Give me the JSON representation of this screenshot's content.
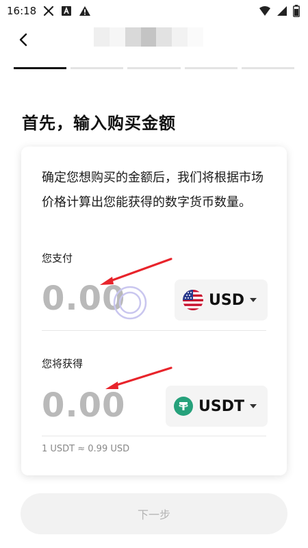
{
  "status_bar": {
    "time": "16:18",
    "icons_left": [
      "settings-tool-icon",
      "accessibility-icon",
      "warning-icon"
    ],
    "icons_right": [
      "wifi-icon",
      "signal-icon",
      "battery-icon"
    ]
  },
  "header": {
    "back_icon": "chevron-left-icon",
    "title": "",
    "title_obscured": true
  },
  "progress": {
    "total_steps": 5,
    "current_step": 1
  },
  "page_title": "首先，输入购买金额",
  "card": {
    "description": "确定您想购买的金额后，我们将根据市场价格计算出您能获得的数字货币数量。",
    "pay": {
      "label": "您支付",
      "amount": "0.00",
      "currency": "USD",
      "currency_icon": "us-flag-icon"
    },
    "receive": {
      "label": "您将获得",
      "amount": "0.00",
      "currency": "USDT",
      "currency_icon": "tether-icon"
    },
    "rate": "1 USDT ≈ 0.99 USD"
  },
  "next_button": {
    "label": "下一步",
    "enabled": false
  },
  "colors": {
    "accent_arrow": "#e8242b",
    "tether_green": "#26a17b",
    "placeholder_gray": "#b9b9b9",
    "progress_active": "#111111",
    "progress_inactive": "#e3e3e3"
  }
}
